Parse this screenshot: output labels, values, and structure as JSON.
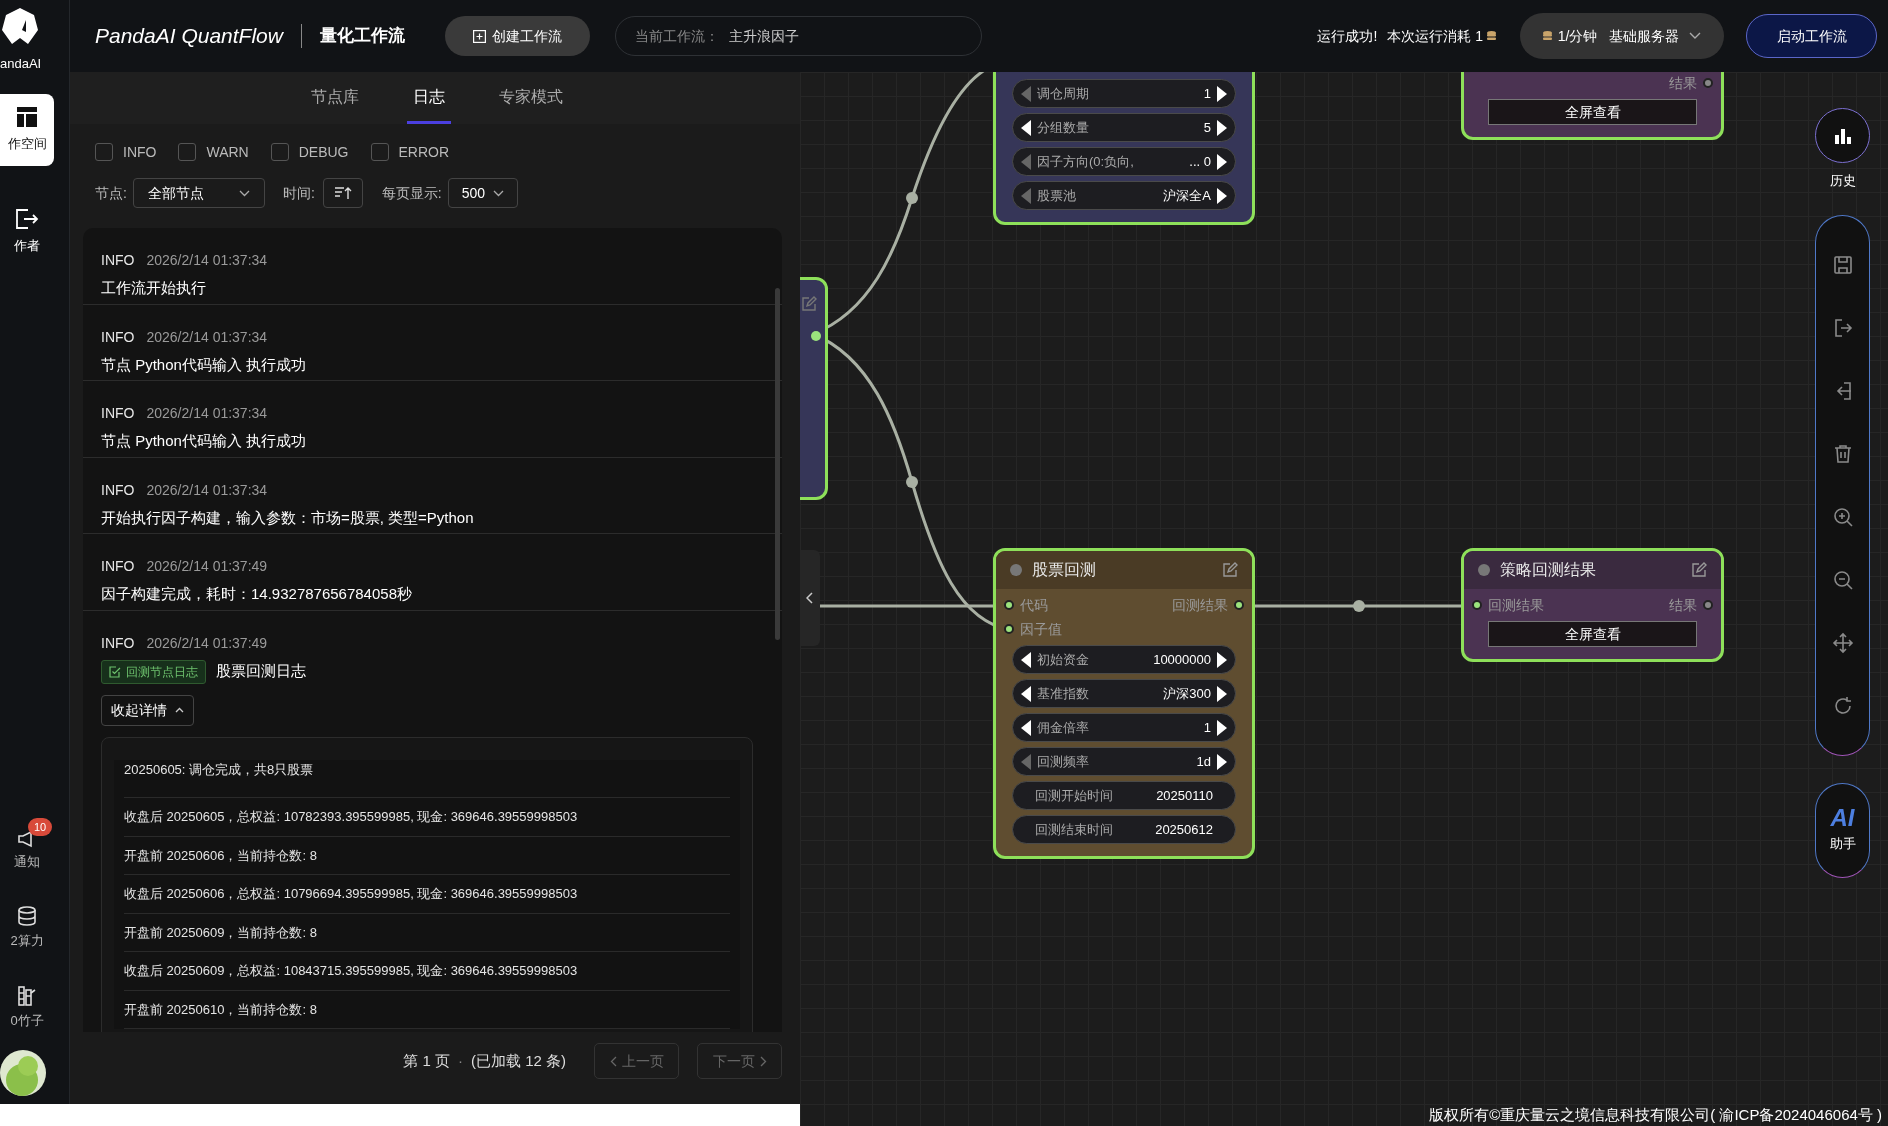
{
  "sidebar": {
    "logo": "andaAI",
    "items": [
      {
        "label": "作空间",
        "selected": true
      },
      {
        "label": "作者",
        "selected": false
      }
    ],
    "bottom_items": [
      {
        "label": "通知",
        "badge": "10"
      },
      {
        "label": "2算力"
      },
      {
        "label": "0竹子"
      }
    ]
  },
  "header": {
    "title": "PandaAI QuantFlow",
    "subtitle": "量化工作流",
    "create_button": "创建工作流",
    "current_workflow": {
      "label": "当前工作流：",
      "value": "主升浪因子"
    },
    "status": "运行成功!",
    "cost": "本次运行消耗 1",
    "server": {
      "rate": "1/分钟",
      "name": "基础服务器"
    },
    "start_button": "启动工作流"
  },
  "log_panel": {
    "tabs": [
      {
        "label": "节点库",
        "selected": false
      },
      {
        "label": "日志",
        "selected": true
      },
      {
        "label": "专家模式",
        "selected": false
      }
    ],
    "levels": [
      {
        "label": "INFO",
        "checked": false
      },
      {
        "label": "WARN",
        "checked": false
      },
      {
        "label": "DEBUG",
        "checked": false
      },
      {
        "label": "ERROR",
        "checked": false
      }
    ],
    "node_filter": {
      "label": "节点:",
      "value": "全部节点"
    },
    "time_sort": {
      "label": "时间:"
    },
    "page_size": {
      "label": "每页显示:",
      "value": "500"
    },
    "entries": [
      {
        "level": "INFO",
        "time": "2026/2/14 01:37:34",
        "message": "工作流开始执行"
      },
      {
        "level": "INFO",
        "time": "2026/2/14 01:37:34",
        "message": "节点 Python代码输入 执行成功"
      },
      {
        "level": "INFO",
        "time": "2026/2/14 01:37:34",
        "message": "节点 Python代码输入 执行成功"
      },
      {
        "level": "INFO",
        "time": "2026/2/14 01:37:34",
        "message": "开始执行因子构建，输入参数：市场=股票, 类型=Python"
      },
      {
        "level": "INFO",
        "time": "2026/2/14 01:37:49",
        "message": "因子构建完成，耗时：14.932787656784058秒"
      },
      {
        "level": "INFO",
        "time": "2026/2/14 01:37:49",
        "badge": "回测节点日志",
        "message": "股票回测日志",
        "toggle": "收起详情",
        "expanded": true,
        "details": [
          "20250605: 调仓完成，共8只股票",
          "收盘后 20250605，总权益: 10782393.395599985, 现金: 369646.39559998503",
          "开盘前 20250606，当前持仓数: 8",
          "收盘后 20250606，总权益: 10796694.395599985, 现金: 369646.39559998503",
          "开盘前 20250609，当前持仓数: 8",
          "收盘后 20250609，总权益: 10843715.395599985, 现金: 369646.39559998503",
          "开盘前 20250610，当前持仓数: 8"
        ]
      }
    ],
    "pagination": {
      "page": "第 1 页",
      "dot": "·",
      "loaded": "(已加载 12 条)",
      "prev": {
        "label": "上一页",
        "disabled": true
      },
      "next": {
        "label": "下一页",
        "disabled": true
      }
    }
  },
  "canvas": {
    "nodes": [
      {
        "kind": "params",
        "rows": [
          {
            "kind": "stepper",
            "label": "调仓周期",
            "value": "1",
            "left_enabled": false
          },
          {
            "kind": "stepper",
            "label": "分组数量",
            "value": "5",
            "left_enabled": true
          },
          {
            "kind": "stepper",
            "label": "因子方向(0:负向,",
            "value": "... 0",
            "left_enabled": false
          },
          {
            "kind": "stepper",
            "label": "股票池",
            "value": "沪深全A",
            "left_enabled": false
          }
        ]
      },
      {
        "kind": "result",
        "outputs": [
          {
            "label": "结果",
            "connected": false
          }
        ],
        "button": "全屏查看"
      },
      {
        "kind": "stub"
      },
      {
        "kind": "backtest",
        "title": "股票回测",
        "inputs": [
          {
            "label": "代码",
            "connected": true
          },
          {
            "label": "因子值",
            "connected": true
          }
        ],
        "outputs": [
          {
            "label": "回测结果",
            "connected": true
          }
        ],
        "rows": [
          {
            "kind": "stepper",
            "label": "初始资金",
            "value": "10000000",
            "left_enabled": true
          },
          {
            "kind": "stepper",
            "label": "基准指数",
            "value": "沪深300",
            "left_enabled": true
          },
          {
            "kind": "stepper",
            "label": "佣金倍率",
            "value": "1",
            "left_enabled": true
          },
          {
            "kind": "stepper",
            "label": "回测频率",
            "value": "1d",
            "left_enabled": false
          },
          {
            "kind": "field",
            "label": "回测开始时间",
            "value": "20250110"
          },
          {
            "kind": "field",
            "label": "回测结束时间",
            "value": "20250612"
          }
        ]
      },
      {
        "kind": "result",
        "title": "策略回测结果",
        "inputs": [
          {
            "label": "回测结果",
            "connected": true
          }
        ],
        "outputs": [
          {
            "label": "结果",
            "connected": false
          }
        ],
        "button": "全屏查看"
      }
    ]
  },
  "toolbar": {
    "history": "历史",
    "assistant_logo": "AI",
    "assistant": "助手"
  },
  "footer": "版权所有©重庆量云之境信息科技有限公司( 渝ICP备2024046064号 )"
}
